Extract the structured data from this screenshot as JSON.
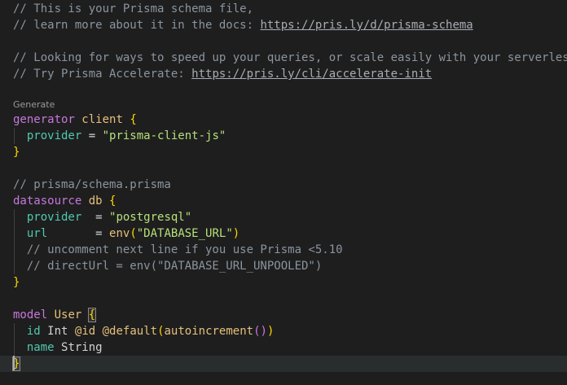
{
  "editor": {
    "codelens_label": "Generate",
    "comments": {
      "c1": "// This is your Prisma schema file,",
      "c2": "// learn more about it in the docs: ",
      "c2_link": "https://pris.ly/d/prisma-schema",
      "c3": "// Looking for ways to speed up your queries, or scale easily with your serverless or edge functions?",
      "c4": "// Try Prisma Accelerate: ",
      "c4_link": "https://pris.ly/cli/accelerate-init",
      "c5": "// prisma/schema.prisma",
      "c6": "// uncomment next line if you use Prisma <5.10",
      "c7": "// directUrl = env(\"DATABASE_URL_UNPOOLED\")"
    },
    "generator": {
      "keyword": "generator",
      "name": "client",
      "provider_key": "provider",
      "provider_value": "\"prisma-client-js\""
    },
    "datasource": {
      "keyword": "datasource",
      "name": "db",
      "provider_key": "provider",
      "provider_value": "\"postgresql\"",
      "url_key": "url",
      "url_fn": "env",
      "url_value": "\"DATABASE_URL\""
    },
    "model": {
      "keyword": "model",
      "name": "User",
      "field1_name": "id",
      "field1_type": "Int",
      "field1_attr1": "@id",
      "field1_attr2": "@default",
      "field1_fn": "autoincrement",
      "field2_name": "name",
      "field2_type": "String"
    },
    "syntax_colors": {
      "background": "#1e1e1e",
      "comment": "#8b949e",
      "keyword": "#c678dd",
      "type_name": "#e5c07b",
      "bracket": "#ffd700",
      "property": "#4ec9b0",
      "string": "#b5e07a"
    }
  }
}
